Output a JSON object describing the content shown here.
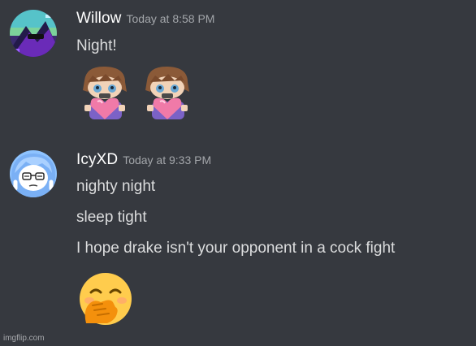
{
  "messages": [
    {
      "username": "Willow",
      "timestamp": "Today at 8:58 PM",
      "lines": [
        "Night!"
      ],
      "avatar": "willow-avatar",
      "attachments": [
        "hug-heart-emote",
        "hug-heart-emote"
      ]
    },
    {
      "username": "IcyXD",
      "timestamp": "Today at 9:33 PM",
      "lines": [
        "nighty night",
        "sleep tight",
        "I hope drake isn't your opponent in a cock fight"
      ],
      "avatar": "icyxd-avatar",
      "attachments": [
        "face-with-hand-over-mouth-emoji"
      ]
    }
  ],
  "watermark": "imgflip.com",
  "colors": {
    "background": "#36393f",
    "username": "#ffffff",
    "timestamp": "#a3a6aa",
    "text": "#dcddde"
  }
}
